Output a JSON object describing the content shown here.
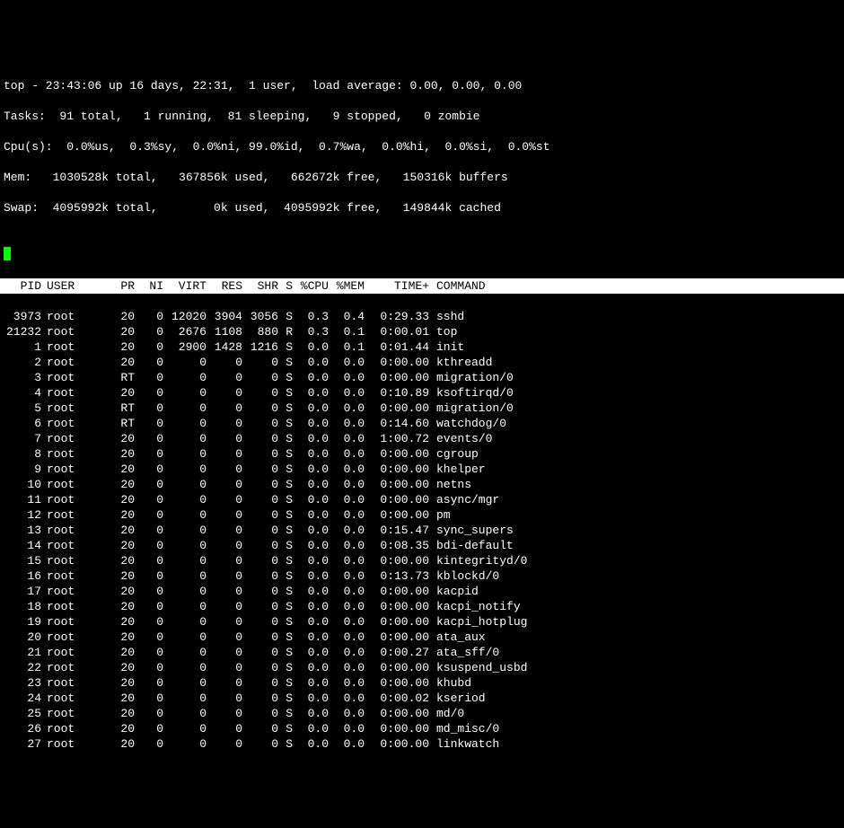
{
  "summary": {
    "line1": "top - 23:43:06 up 16 days, 22:31,  1 user,  load average: 0.00, 0.00, 0.00",
    "line2": "Tasks:  91 total,   1 running,  81 sleeping,   9 stopped,   0 zombie",
    "line3": "Cpu(s):  0.0%us,  0.3%sy,  0.0%ni, 99.0%id,  0.7%wa,  0.0%hi,  0.0%si,  0.0%st",
    "line4": "Mem:   1030528k total,   367856k used,   662672k free,   150316k buffers",
    "line5": "Swap:  4095992k total,        0k used,  4095992k free,   149844k cached"
  },
  "columns": {
    "pid": "PID",
    "user": "USER",
    "pr": "PR",
    "ni": "NI",
    "virt": "VIRT",
    "res": "RES",
    "shr": "SHR",
    "s": "S",
    "cpu": "%CPU",
    "mem": "%MEM",
    "time": "TIME+",
    "cmd": "COMMAND"
  },
  "processes": [
    {
      "pid": "3973",
      "user": "root",
      "pr": "20",
      "ni": "0",
      "virt": "12020",
      "res": "3904",
      "shr": "3056",
      "s": "S",
      "cpu": "0.3",
      "mem": "0.4",
      "time": "0:29.33",
      "cmd": "sshd"
    },
    {
      "pid": "21232",
      "user": "root",
      "pr": "20",
      "ni": "0",
      "virt": "2676",
      "res": "1108",
      "shr": "880",
      "s": "R",
      "cpu": "0.3",
      "mem": "0.1",
      "time": "0:00.01",
      "cmd": "top"
    },
    {
      "pid": "1",
      "user": "root",
      "pr": "20",
      "ni": "0",
      "virt": "2900",
      "res": "1428",
      "shr": "1216",
      "s": "S",
      "cpu": "0.0",
      "mem": "0.1",
      "time": "0:01.44",
      "cmd": "init"
    },
    {
      "pid": "2",
      "user": "root",
      "pr": "20",
      "ni": "0",
      "virt": "0",
      "res": "0",
      "shr": "0",
      "s": "S",
      "cpu": "0.0",
      "mem": "0.0",
      "time": "0:00.00",
      "cmd": "kthreadd"
    },
    {
      "pid": "3",
      "user": "root",
      "pr": "RT",
      "ni": "0",
      "virt": "0",
      "res": "0",
      "shr": "0",
      "s": "S",
      "cpu": "0.0",
      "mem": "0.0",
      "time": "0:00.00",
      "cmd": "migration/0"
    },
    {
      "pid": "4",
      "user": "root",
      "pr": "20",
      "ni": "0",
      "virt": "0",
      "res": "0",
      "shr": "0",
      "s": "S",
      "cpu": "0.0",
      "mem": "0.0",
      "time": "0:10.89",
      "cmd": "ksoftirqd/0"
    },
    {
      "pid": "5",
      "user": "root",
      "pr": "RT",
      "ni": "0",
      "virt": "0",
      "res": "0",
      "shr": "0",
      "s": "S",
      "cpu": "0.0",
      "mem": "0.0",
      "time": "0:00.00",
      "cmd": "migration/0"
    },
    {
      "pid": "6",
      "user": "root",
      "pr": "RT",
      "ni": "0",
      "virt": "0",
      "res": "0",
      "shr": "0",
      "s": "S",
      "cpu": "0.0",
      "mem": "0.0",
      "time": "0:14.60",
      "cmd": "watchdog/0"
    },
    {
      "pid": "7",
      "user": "root",
      "pr": "20",
      "ni": "0",
      "virt": "0",
      "res": "0",
      "shr": "0",
      "s": "S",
      "cpu": "0.0",
      "mem": "0.0",
      "time": "1:00.72",
      "cmd": "events/0"
    },
    {
      "pid": "8",
      "user": "root",
      "pr": "20",
      "ni": "0",
      "virt": "0",
      "res": "0",
      "shr": "0",
      "s": "S",
      "cpu": "0.0",
      "mem": "0.0",
      "time": "0:00.00",
      "cmd": "cgroup"
    },
    {
      "pid": "9",
      "user": "root",
      "pr": "20",
      "ni": "0",
      "virt": "0",
      "res": "0",
      "shr": "0",
      "s": "S",
      "cpu": "0.0",
      "mem": "0.0",
      "time": "0:00.00",
      "cmd": "khelper"
    },
    {
      "pid": "10",
      "user": "root",
      "pr": "20",
      "ni": "0",
      "virt": "0",
      "res": "0",
      "shr": "0",
      "s": "S",
      "cpu": "0.0",
      "mem": "0.0",
      "time": "0:00.00",
      "cmd": "netns"
    },
    {
      "pid": "11",
      "user": "root",
      "pr": "20",
      "ni": "0",
      "virt": "0",
      "res": "0",
      "shr": "0",
      "s": "S",
      "cpu": "0.0",
      "mem": "0.0",
      "time": "0:00.00",
      "cmd": "async/mgr"
    },
    {
      "pid": "12",
      "user": "root",
      "pr": "20",
      "ni": "0",
      "virt": "0",
      "res": "0",
      "shr": "0",
      "s": "S",
      "cpu": "0.0",
      "mem": "0.0",
      "time": "0:00.00",
      "cmd": "pm"
    },
    {
      "pid": "13",
      "user": "root",
      "pr": "20",
      "ni": "0",
      "virt": "0",
      "res": "0",
      "shr": "0",
      "s": "S",
      "cpu": "0.0",
      "mem": "0.0",
      "time": "0:15.47",
      "cmd": "sync_supers"
    },
    {
      "pid": "14",
      "user": "root",
      "pr": "20",
      "ni": "0",
      "virt": "0",
      "res": "0",
      "shr": "0",
      "s": "S",
      "cpu": "0.0",
      "mem": "0.0",
      "time": "0:08.35",
      "cmd": "bdi-default"
    },
    {
      "pid": "15",
      "user": "root",
      "pr": "20",
      "ni": "0",
      "virt": "0",
      "res": "0",
      "shr": "0",
      "s": "S",
      "cpu": "0.0",
      "mem": "0.0",
      "time": "0:00.00",
      "cmd": "kintegrityd/0"
    },
    {
      "pid": "16",
      "user": "root",
      "pr": "20",
      "ni": "0",
      "virt": "0",
      "res": "0",
      "shr": "0",
      "s": "S",
      "cpu": "0.0",
      "mem": "0.0",
      "time": "0:13.73",
      "cmd": "kblockd/0"
    },
    {
      "pid": "17",
      "user": "root",
      "pr": "20",
      "ni": "0",
      "virt": "0",
      "res": "0",
      "shr": "0",
      "s": "S",
      "cpu": "0.0",
      "mem": "0.0",
      "time": "0:00.00",
      "cmd": "kacpid"
    },
    {
      "pid": "18",
      "user": "root",
      "pr": "20",
      "ni": "0",
      "virt": "0",
      "res": "0",
      "shr": "0",
      "s": "S",
      "cpu": "0.0",
      "mem": "0.0",
      "time": "0:00.00",
      "cmd": "kacpi_notify"
    },
    {
      "pid": "19",
      "user": "root",
      "pr": "20",
      "ni": "0",
      "virt": "0",
      "res": "0",
      "shr": "0",
      "s": "S",
      "cpu": "0.0",
      "mem": "0.0",
      "time": "0:00.00",
      "cmd": "kacpi_hotplug"
    },
    {
      "pid": "20",
      "user": "root",
      "pr": "20",
      "ni": "0",
      "virt": "0",
      "res": "0",
      "shr": "0",
      "s": "S",
      "cpu": "0.0",
      "mem": "0.0",
      "time": "0:00.00",
      "cmd": "ata_aux"
    },
    {
      "pid": "21",
      "user": "root",
      "pr": "20",
      "ni": "0",
      "virt": "0",
      "res": "0",
      "shr": "0",
      "s": "S",
      "cpu": "0.0",
      "mem": "0.0",
      "time": "0:00.27",
      "cmd": "ata_sff/0"
    },
    {
      "pid": "22",
      "user": "root",
      "pr": "20",
      "ni": "0",
      "virt": "0",
      "res": "0",
      "shr": "0",
      "s": "S",
      "cpu": "0.0",
      "mem": "0.0",
      "time": "0:00.00",
      "cmd": "ksuspend_usbd"
    },
    {
      "pid": "23",
      "user": "root",
      "pr": "20",
      "ni": "0",
      "virt": "0",
      "res": "0",
      "shr": "0",
      "s": "S",
      "cpu": "0.0",
      "mem": "0.0",
      "time": "0:00.00",
      "cmd": "khubd"
    },
    {
      "pid": "24",
      "user": "root",
      "pr": "20",
      "ni": "0",
      "virt": "0",
      "res": "0",
      "shr": "0",
      "s": "S",
      "cpu": "0.0",
      "mem": "0.0",
      "time": "0:00.02",
      "cmd": "kseriod"
    },
    {
      "pid": "25",
      "user": "root",
      "pr": "20",
      "ni": "0",
      "virt": "0",
      "res": "0",
      "shr": "0",
      "s": "S",
      "cpu": "0.0",
      "mem": "0.0",
      "time": "0:00.00",
      "cmd": "md/0"
    },
    {
      "pid": "26",
      "user": "root",
      "pr": "20",
      "ni": "0",
      "virt": "0",
      "res": "0",
      "shr": "0",
      "s": "S",
      "cpu": "0.0",
      "mem": "0.0",
      "time": "0:00.00",
      "cmd": "md_misc/0"
    },
    {
      "pid": "27",
      "user": "root",
      "pr": "20",
      "ni": "0",
      "virt": "0",
      "res": "0",
      "shr": "0",
      "s": "S",
      "cpu": "0.0",
      "mem": "0.0",
      "time": "0:00.00",
      "cmd": "linkwatch"
    }
  ]
}
